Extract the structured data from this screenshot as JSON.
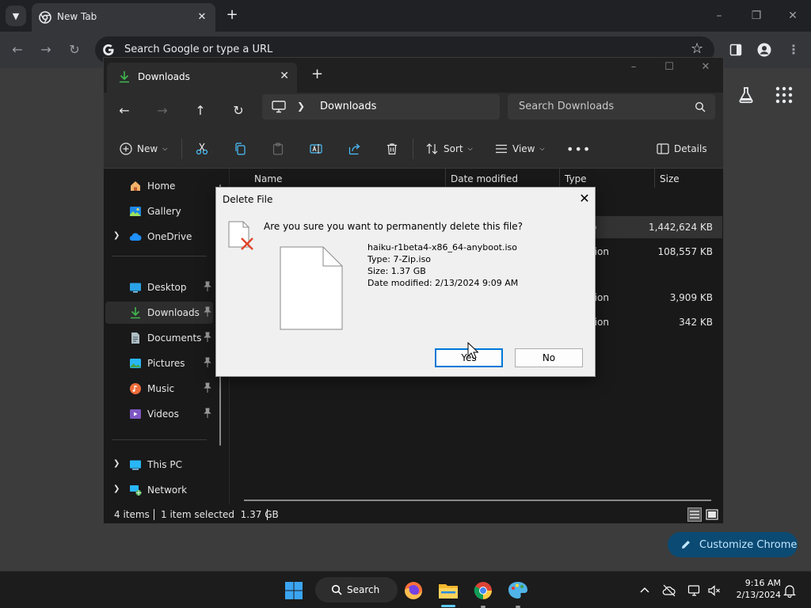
{
  "chrome": {
    "tab_title": "New Tab",
    "omnibox_placeholder": "Search Google or type a URL",
    "customize_label": "Customize Chrome"
  },
  "explorer": {
    "tab_title": "Downloads",
    "address": "Downloads",
    "search_placeholder": "Search Downloads",
    "toolbar": {
      "new_label": "New",
      "sort_label": "Sort",
      "view_label": "View",
      "details_label": "Details"
    },
    "sidebar": [
      {
        "label": "Home",
        "icon": "home-icon",
        "pinned": false
      },
      {
        "label": "Gallery",
        "icon": "gallery-icon",
        "pinned": false
      },
      {
        "label": "OneDrive",
        "icon": "cloud-icon",
        "pinned": false,
        "expandable": true
      },
      {
        "label": "Desktop",
        "icon": "desktop-icon",
        "pinned": true
      },
      {
        "label": "Downloads",
        "icon": "downloads-icon",
        "pinned": true,
        "selected": true
      },
      {
        "label": "Documents",
        "icon": "documents-icon",
        "pinned": true
      },
      {
        "label": "Pictures",
        "icon": "pictures-icon",
        "pinned": true
      },
      {
        "label": "Music",
        "icon": "music-icon",
        "pinned": true
      },
      {
        "label": "Videos",
        "icon": "videos-icon",
        "pinned": true
      },
      {
        "label": "This PC",
        "icon": "pc-icon",
        "expandable": true
      },
      {
        "label": "Network",
        "icon": "network-icon",
        "expandable": true
      }
    ],
    "columns": [
      "Name",
      "Date modified",
      "Type",
      "Size"
    ],
    "rows": [
      {
        "type": "o",
        "size": "1,442,624 KB",
        "selected": true
      },
      {
        "type": "tion",
        "size": "108,557 KB"
      },
      {
        "type": "tion",
        "size": "3,909 KB"
      },
      {
        "type": "tion",
        "size": "342 KB"
      }
    ],
    "status": {
      "items": "4 items",
      "selected": "1 item selected  1.37 GB"
    }
  },
  "dialog": {
    "title": "Delete File",
    "question": "Are you sure you want to permanently delete this file?",
    "file_name": "haiku-r1beta4-x86_64-anyboot.iso",
    "file_type": "Type: 7-Zip.iso",
    "file_size": "Size: 1.37 GB",
    "file_date": "Date modified: 2/13/2024 9:09 AM",
    "yes_label": "Yes",
    "no_label": "No"
  },
  "taskbar": {
    "search_label": "Search",
    "time": "9:16 AM",
    "date": "2/13/2024"
  },
  "colors": {
    "accent": "#0078d7",
    "customize_bg": "#0b4a73",
    "delete_x": "#e0452b"
  }
}
